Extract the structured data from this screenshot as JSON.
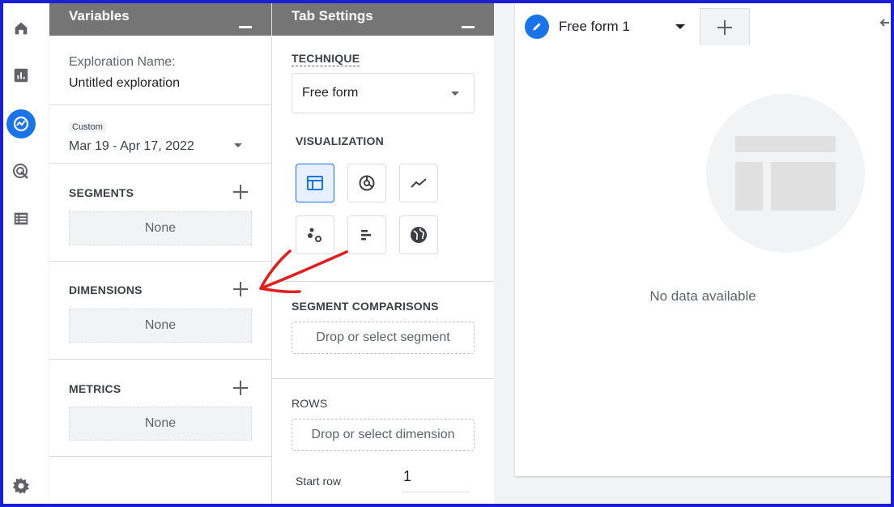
{
  "rail": {
    "icons": [
      "home-icon",
      "reports-icon",
      "explore-icon",
      "advertising-icon",
      "configure-icon",
      "settings-icon"
    ]
  },
  "variables": {
    "title": "Variables",
    "exploration_label": "Exploration Name:",
    "exploration_value": "Untitled exploration",
    "date_badge": "Custom",
    "date_range": "Mar 19 - Apr 17, 2022",
    "segments_label": "SEGMENTS",
    "segments_value": "None",
    "dimensions_label": "DIMENSIONS",
    "dimensions_value": "None",
    "metrics_label": "METRICS",
    "metrics_value": "None"
  },
  "tab_settings": {
    "title": "Tab Settings",
    "technique_label": "TECHNIQUE",
    "technique_value": "Free form",
    "visualization_label": "VISUALIZATION",
    "visualizations": [
      "table-icon",
      "donut-chart-icon",
      "line-chart-icon",
      "scatter-plot-icon",
      "bar-chart-icon",
      "geo-map-icon"
    ],
    "segment_comparisons_label": "SEGMENT COMPARISONS",
    "segment_comparisons_placeholder": "Drop or select segment",
    "rows_label": "ROWS",
    "rows_placeholder": "Drop or select dimension",
    "start_row_label": "Start row",
    "start_row_value": "1"
  },
  "canvas": {
    "tab_label": "Free form 1",
    "empty_text": "No data available"
  },
  "colors": {
    "border_frame": "#1a1fd6",
    "accent": "#1a73e8",
    "annotation_arrow": "#e0201c",
    "panel_header": "#757575"
  }
}
